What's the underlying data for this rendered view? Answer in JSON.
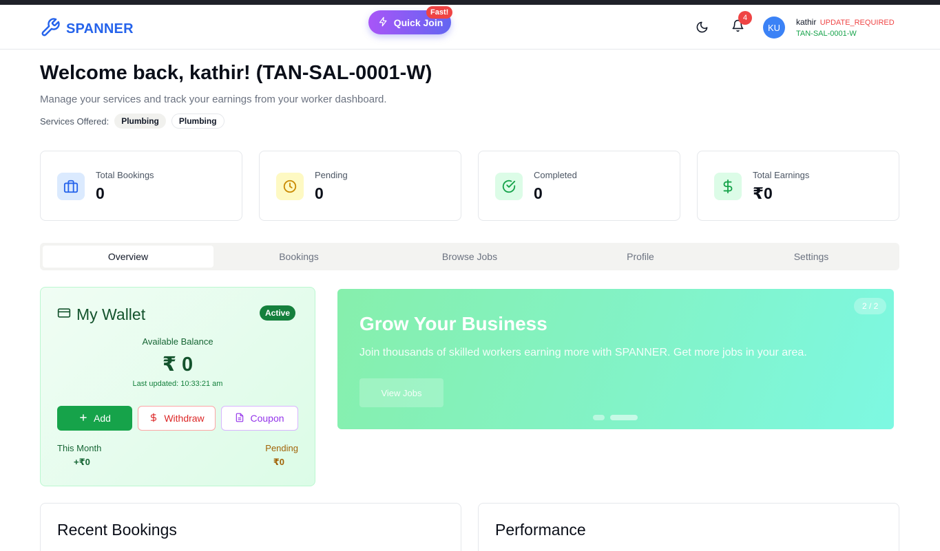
{
  "header": {
    "logo_text": "SPANNER",
    "quick_join_label": "Quick Join",
    "fast_badge": "Fast!",
    "notification_count": "4",
    "avatar_initials": "KU",
    "user_name": "kathir",
    "user_status": "UPDATE_REQUIRED",
    "user_id": "TAN-SAL-0001-W"
  },
  "welcome": {
    "title": "Welcome back, kathir! (TAN-SAL-0001-W)",
    "subtitle": "Manage your services and track your earnings from your worker dashboard.",
    "services_label": "Services Offered:",
    "services": [
      "Plumbing",
      "Plumbing"
    ]
  },
  "stats": [
    {
      "label": "Total Bookings",
      "value": "0",
      "icon": "briefcase-icon",
      "color": "#2563eb"
    },
    {
      "label": "Pending",
      "value": "0",
      "icon": "clock-icon",
      "color": "#ca8a04"
    },
    {
      "label": "Completed",
      "value": "0",
      "icon": "check-circle-icon",
      "color": "#16a34a"
    },
    {
      "label": "Total Earnings",
      "value": "₹0",
      "icon": "dollar-icon",
      "color": "#16a34a"
    }
  ],
  "tabs": [
    {
      "label": "Overview",
      "active": true
    },
    {
      "label": "Bookings"
    },
    {
      "label": "Browse Jobs"
    },
    {
      "label": "Profile"
    },
    {
      "label": "Settings"
    }
  ],
  "wallet": {
    "title": "My Wallet",
    "status": "Active",
    "balance_label": "Available Balance",
    "balance": "₹ 0",
    "last_updated": "Last updated: 10:33:21 am",
    "add_label": "Add",
    "withdraw_label": "Withdraw",
    "coupon_label": "Coupon",
    "this_month_label": "This Month",
    "this_month_value": "+₹0",
    "pending_label": "Pending",
    "pending_value": "₹0"
  },
  "banner": {
    "counter": "2 / 2",
    "title": "Grow Your Business",
    "description": "Join thousands of skilled workers earning more with SPANNER. Get more jobs in your area.",
    "button_label": "View Jobs"
  },
  "panels": {
    "recent_bookings_title": "Recent Bookings",
    "performance_title": "Performance"
  },
  "colors": {
    "brand": "#2563eb",
    "success": "#16a34a",
    "danger": "#ef4444",
    "accent": "#9333ea"
  }
}
